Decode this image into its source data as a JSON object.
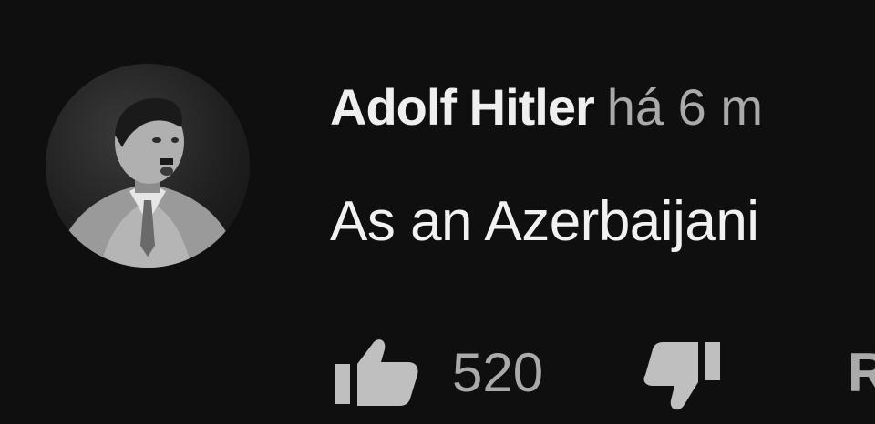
{
  "comment": {
    "author": "Adolf Hitler",
    "timestamp": "há 6 m",
    "text": "As an Azerbaijani",
    "like_count": "520",
    "reply_label": "R"
  },
  "icons": {
    "like": "thumbs-up-icon",
    "dislike": "thumbs-down-icon"
  },
  "colors": {
    "background": "#0f0f0f",
    "author_text": "#efefef",
    "body_text": "#f1f1f1",
    "secondary_text": "#aaaaaa"
  }
}
